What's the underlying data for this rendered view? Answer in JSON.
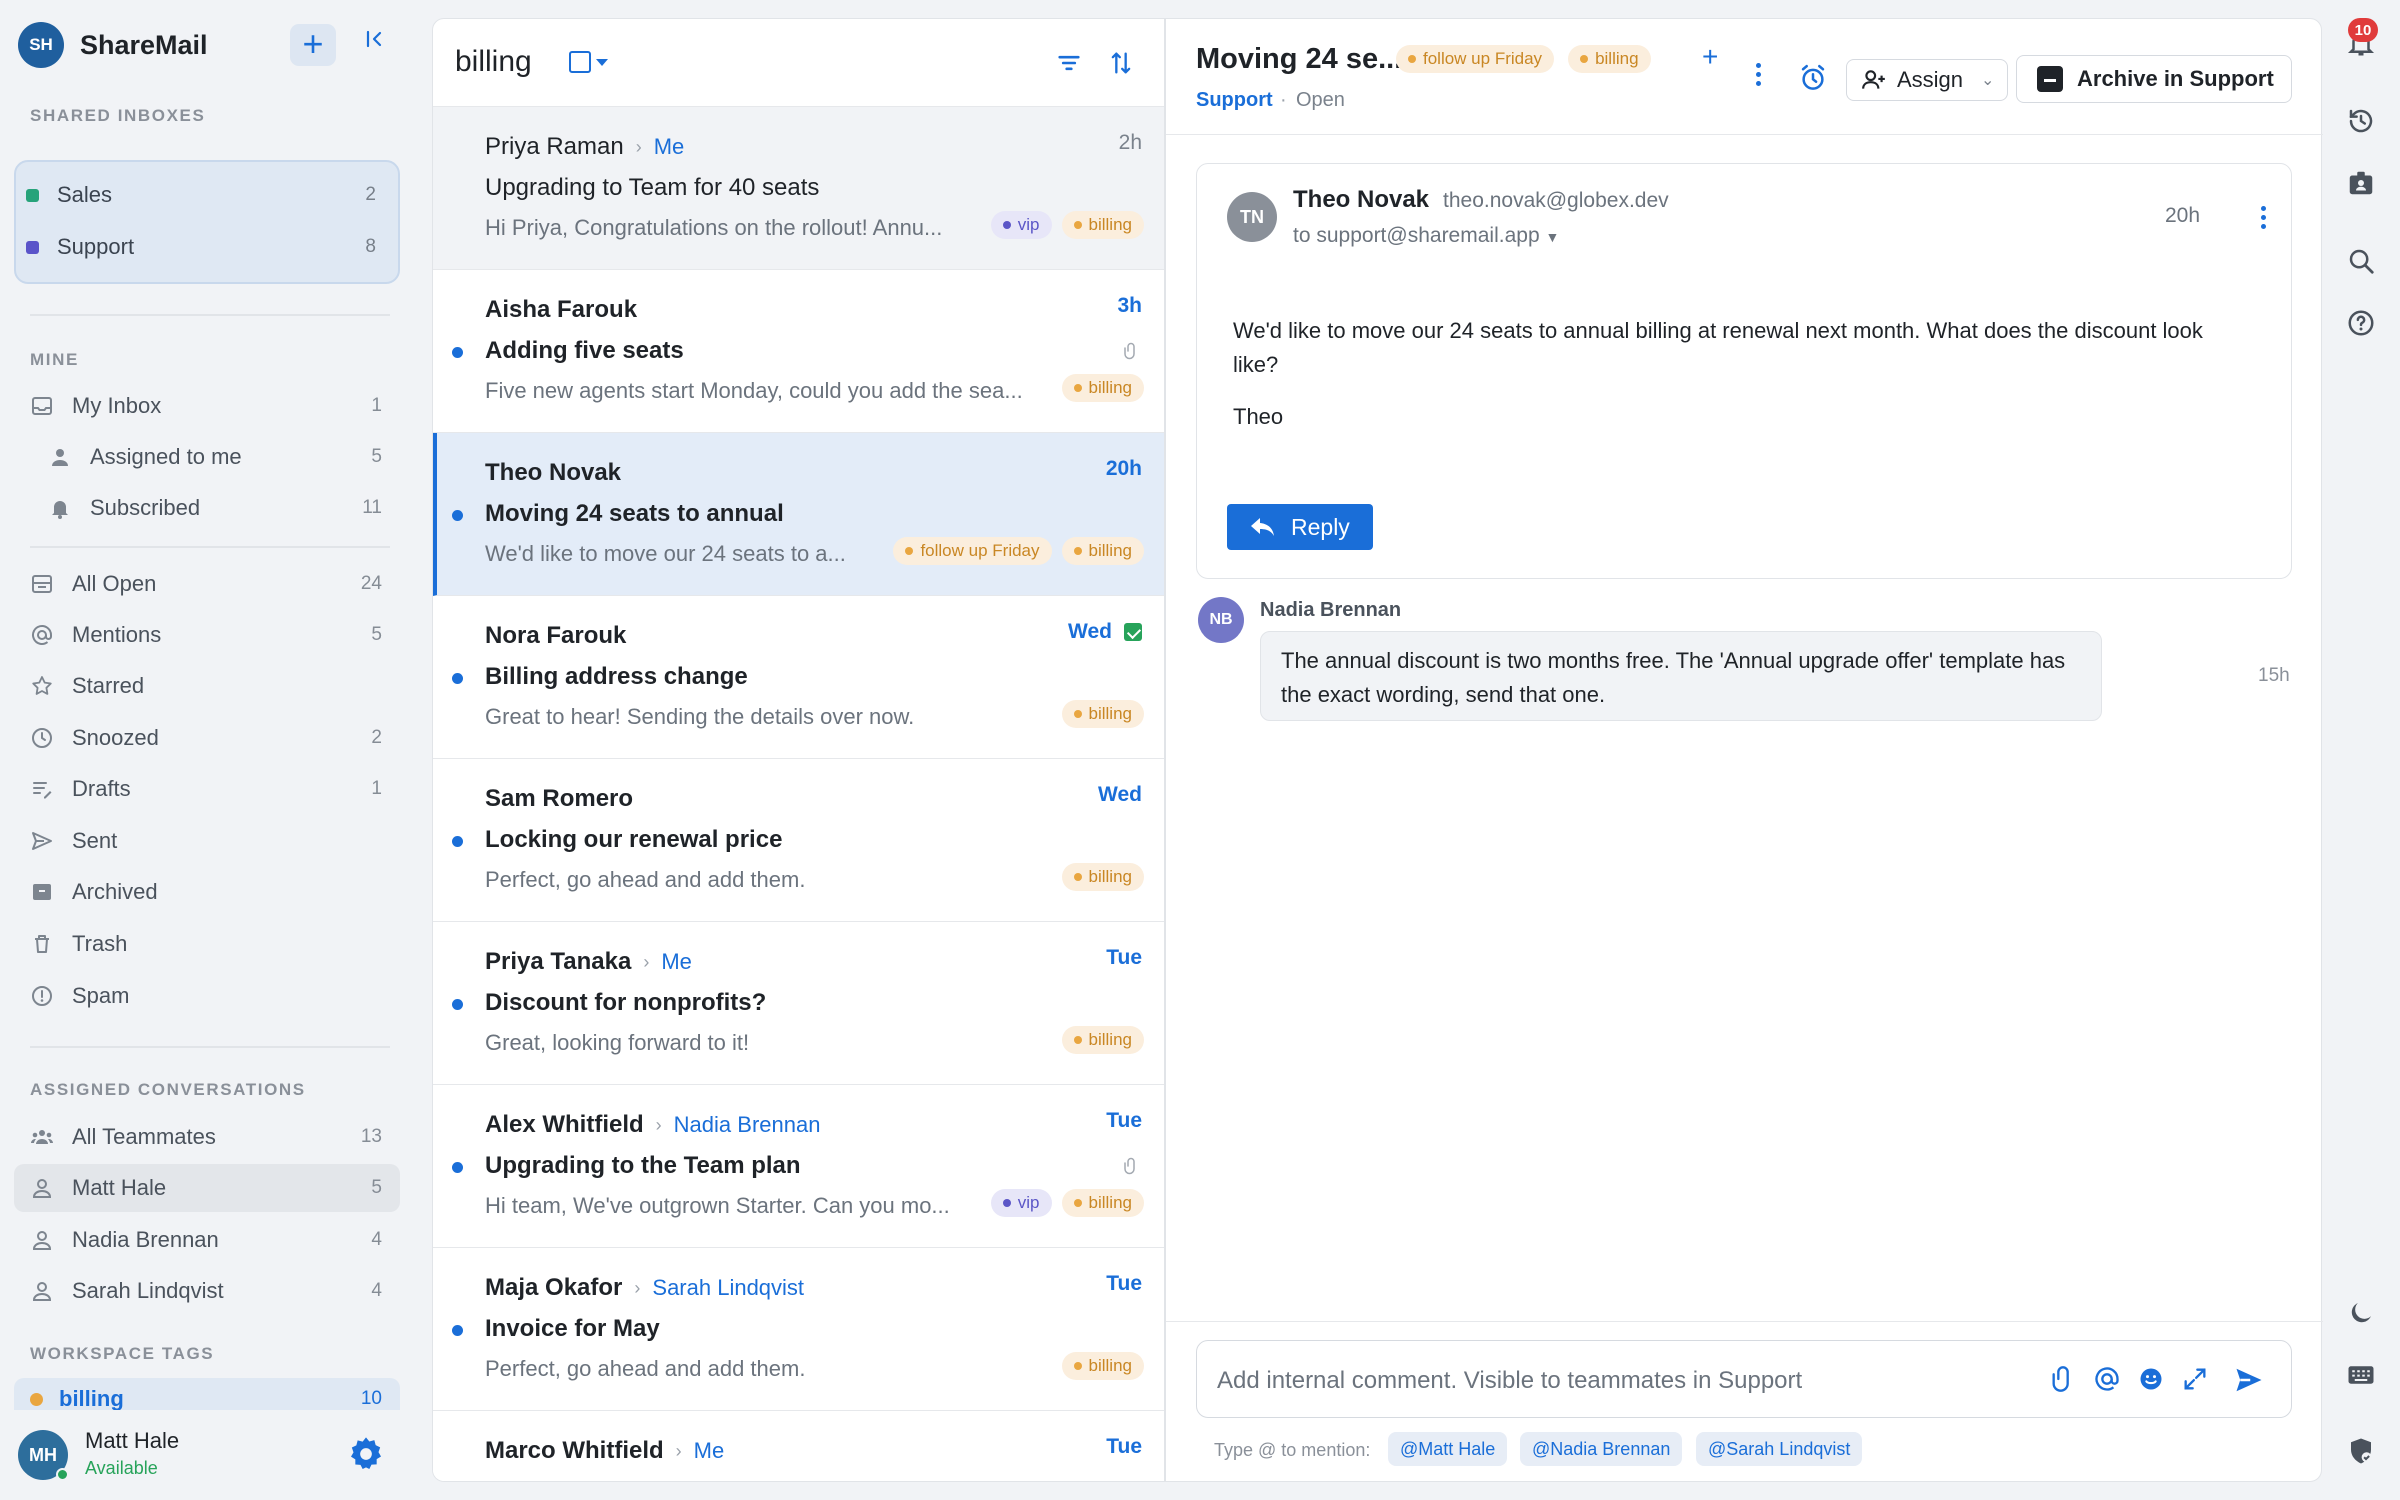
{
  "brand": {
    "initials": "SH",
    "name": "ShareMail"
  },
  "sidebar": {
    "shared_title": "SHARED INBOXES",
    "shared": [
      {
        "label": "Sales",
        "count": "2",
        "color": "#26a37a"
      },
      {
        "label": "Support",
        "count": "8",
        "color": "#5a54c9"
      }
    ],
    "mine_title": "MINE",
    "mine": [
      {
        "label": "My Inbox",
        "count": "1",
        "icon": "inbox-icon"
      },
      {
        "label": "Assigned to me",
        "count": "5",
        "icon": "person-icon"
      },
      {
        "label": "Subscribed",
        "count": "11",
        "icon": "bell-icon"
      }
    ],
    "folders": [
      {
        "label": "All Open",
        "count": "24",
        "icon": "all-open-icon"
      },
      {
        "label": "Mentions",
        "count": "5",
        "icon": "at-icon"
      },
      {
        "label": "Starred",
        "count": "",
        "icon": "star-icon"
      },
      {
        "label": "Snoozed",
        "count": "2",
        "icon": "clock-icon"
      },
      {
        "label": "Drafts",
        "count": "1",
        "icon": "draft-icon"
      },
      {
        "label": "Sent",
        "count": "",
        "icon": "send-icon"
      },
      {
        "label": "Archived",
        "count": "",
        "icon": "archive-icon"
      },
      {
        "label": "Trash",
        "count": "",
        "icon": "trash-icon"
      },
      {
        "label": "Spam",
        "count": "",
        "icon": "spam-icon"
      }
    ],
    "assigned_title": "ASSIGNED CONVERSATIONS",
    "assigned": [
      {
        "label": "All Teammates",
        "count": "13",
        "icon": "team-icon"
      },
      {
        "label": "Matt Hale",
        "count": "5",
        "icon": "person-icon"
      },
      {
        "label": "Nadia Brennan",
        "count": "4",
        "icon": "person-icon"
      },
      {
        "label": "Sarah Lindqvist",
        "count": "4",
        "icon": "person-icon"
      }
    ],
    "tags_title": "WORKSPACE TAGS",
    "tag": {
      "label": "billing",
      "count": "10",
      "color": "#e9a640"
    },
    "user": {
      "initials": "MH",
      "name": "Matt Hale",
      "status": "Available"
    }
  },
  "list": {
    "title": "billing",
    "rows": [
      {
        "from": "Priya Raman",
        "to": "Me",
        "time": "2h",
        "subject": "Upgrading to Team for 40 seats",
        "preview": "Hi Priya, Congratulations on the rollout! Annu...",
        "tags": [
          "vip",
          "billing"
        ],
        "unread": false
      },
      {
        "from": "Aisha Farouk",
        "to": "",
        "time": "3h",
        "subject": "Adding five seats",
        "preview": "Five new agents start Monday, could you add the sea...",
        "tags": [
          "billing"
        ],
        "unread": true,
        "attachment": true
      },
      {
        "from": "Theo Novak",
        "to": "",
        "time": "20h",
        "subject": "Moving 24 seats to annual",
        "preview": "We'd like to move our 24 seats to a...",
        "tags": [
          "follow up Friday",
          "billing"
        ],
        "unread": true
      },
      {
        "from": "Nora Farouk",
        "to": "",
        "time": "Wed",
        "subject": "Billing address change",
        "preview": "Great to hear! Sending the details over now.",
        "tags": [
          "billing"
        ],
        "unread": true,
        "flag": true
      },
      {
        "from": "Sam Romero",
        "to": "",
        "time": "Wed",
        "subject": "Locking our renewal price",
        "preview": "Perfect, go ahead and add them.",
        "tags": [
          "billing"
        ],
        "unread": true
      },
      {
        "from": "Priya Tanaka",
        "to": "Me",
        "time": "Tue",
        "subject": "Discount for nonprofits?",
        "preview": "Great, looking forward to it!",
        "tags": [
          "billing"
        ],
        "unread": true
      },
      {
        "from": "Alex Whitfield",
        "to": "Nadia Brennan",
        "time": "Tue",
        "subject": "Upgrading to the Team plan",
        "preview": "Hi team, We've outgrown Starter. Can you mo...",
        "tags": [
          "vip",
          "billing"
        ],
        "unread": true,
        "attachment": true
      },
      {
        "from": "Maja Okafor",
        "to": "Sarah Lindqvist",
        "time": "Tue",
        "subject": "Invoice for May",
        "preview": "Perfect, go ahead and add them.",
        "tags": [
          "billing"
        ],
        "unread": true
      },
      {
        "from": "Marco Whitfield",
        "to": "Me",
        "time": "Tue",
        "subject": "",
        "preview": "",
        "tags": [],
        "unread": false
      }
    ]
  },
  "conv": {
    "title": "Moving 24 se...",
    "tag1": "follow up Friday",
    "tag2": "billing",
    "inbox": "Support",
    "state": "Open",
    "assign_label": "Assign",
    "archive_label": "Archive in Support",
    "message": {
      "initials": "TN",
      "from": "Theo Novak",
      "email": "theo.novak@globex.dev",
      "to": "to support@sharemail.app",
      "time": "20h",
      "body": "We'd like to move our 24 seats to annual billing at renewal next month. What does the discount look like?",
      "signature": "Theo",
      "reply_label": "Reply"
    },
    "note": {
      "initials": "NB",
      "author": "Nadia Brennan",
      "text": "The annual discount is two months free. The 'Annual upgrade offer' template has the exact wording, send that one.",
      "time": "15h"
    },
    "composer": {
      "placeholder": "Add internal comment. Visible to teammates in Support",
      "mention_hint": "Type @ to mention:",
      "mentions": [
        "@Matt Hale",
        "@Nadia Brennan",
        "@Sarah Lindqvist"
      ]
    }
  },
  "rail": {
    "notifications": "10"
  }
}
